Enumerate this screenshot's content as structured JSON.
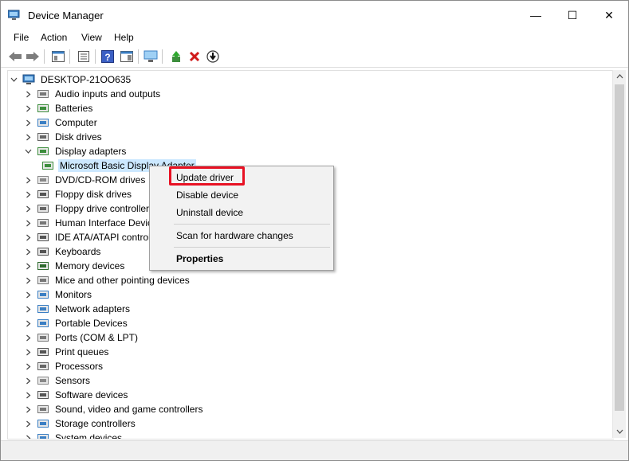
{
  "window": {
    "title": "Device Manager",
    "controls": {
      "minimize": "—",
      "maximize": "☐",
      "close": "✕"
    }
  },
  "menu": [
    "File",
    "Action",
    "View",
    "Help"
  ],
  "toolbar": {
    "icons": [
      "back-arrow-icon",
      "forward-arrow-icon",
      "properties-pane-icon",
      "show-hidden-icon",
      "help-icon",
      "action-pane-icon",
      "monitor-icon",
      "update-driver-icon",
      "uninstall-icon",
      "download-icon"
    ]
  },
  "tree": {
    "root": "DESKTOP-21OO635",
    "categories": [
      {
        "label": "Audio inputs and outputs",
        "icon": "speaker-icon",
        "expanded": false
      },
      {
        "label": "Batteries",
        "icon": "battery-icon",
        "expanded": false
      },
      {
        "label": "Computer",
        "icon": "computer-icon",
        "expanded": false
      },
      {
        "label": "Disk drives",
        "icon": "disk-drive-icon",
        "expanded": false
      },
      {
        "label": "Display adapters",
        "icon": "display-adapter-icon",
        "expanded": true
      },
      {
        "label": "Microsoft Basic Display Adapter",
        "icon": "display-adapter-icon",
        "child": true,
        "selected": true
      },
      {
        "label": "DVD/CD-ROM drives",
        "icon": "dvd-drive-icon",
        "expanded": false
      },
      {
        "label": "Floppy disk drives",
        "icon": "floppy-disk-icon",
        "expanded": false
      },
      {
        "label": "Floppy drive controllers",
        "icon": "floppy-controller-icon",
        "expanded": false
      },
      {
        "label": "Human Interface Devices",
        "icon": "hid-icon",
        "expanded": false
      },
      {
        "label": "IDE ATA/ATAPI controllers",
        "icon": "ide-controller-icon",
        "expanded": false
      },
      {
        "label": "Keyboards",
        "icon": "keyboard-icon",
        "expanded": false
      },
      {
        "label": "Memory devices",
        "icon": "memory-icon",
        "expanded": false
      },
      {
        "label": "Mice and other pointing devices",
        "icon": "mouse-icon",
        "expanded": false
      },
      {
        "label": "Monitors",
        "icon": "monitor-icon",
        "expanded": false
      },
      {
        "label": "Network adapters",
        "icon": "network-adapter-icon",
        "expanded": false
      },
      {
        "label": "Portable Devices",
        "icon": "portable-device-icon",
        "expanded": false
      },
      {
        "label": "Ports (COM & LPT)",
        "icon": "port-icon",
        "expanded": false
      },
      {
        "label": "Print queues",
        "icon": "printer-icon",
        "expanded": false
      },
      {
        "label": "Processors",
        "icon": "processor-icon",
        "expanded": false
      },
      {
        "label": "Sensors",
        "icon": "sensor-icon",
        "expanded": false
      },
      {
        "label": "Software devices",
        "icon": "software-device-icon",
        "expanded": false
      },
      {
        "label": "Sound, video and game controllers",
        "icon": "sound-controller-icon",
        "expanded": false
      },
      {
        "label": "Storage controllers",
        "icon": "storage-controller-icon",
        "expanded": false
      },
      {
        "label": "System devices",
        "icon": "system-device-icon",
        "expanded": false
      }
    ]
  },
  "context_menu": {
    "items": [
      "Update driver",
      "Disable device",
      "Uninstall device",
      "Scan for hardware changes",
      "Properties"
    ],
    "highlighted": "Update driver",
    "highlight_color": "#e81123"
  },
  "colors": {
    "selection": "#cce8ff",
    "highlight": "#e81123"
  }
}
